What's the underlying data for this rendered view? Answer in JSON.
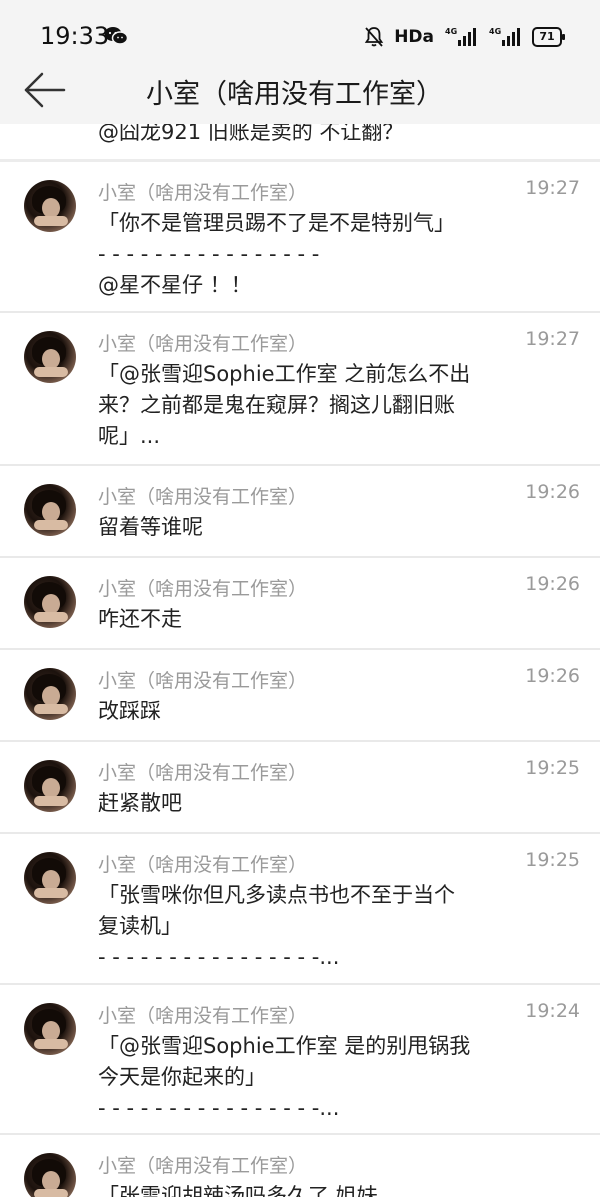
{
  "status_bar": {
    "time": "19:33",
    "hd": "HDa",
    "net1": "4G",
    "net2": "4G",
    "battery": "71"
  },
  "header": {
    "title": "小室（啥用没有工作室）"
  },
  "cut_message": "@囧龙921 旧账是卖的 不让翻？",
  "messages": [
    {
      "sender": "小室（啥用没有工作室）",
      "time": "19:27",
      "lines": [
        "「你不是管理员踢不了是不是特别气」",
        "- - - - - - - - - - - - - - - -",
        "@星不星仔 ！！"
      ]
    },
    {
      "sender": "小室（啥用没有工作室）",
      "time": "19:27",
      "lines": [
        "「@张雪迎Sophie工作室 之前怎么不出",
        "来？之前都是鬼在窥屏？搁这儿翻旧账",
        "呢」..."
      ]
    },
    {
      "sender": "小室（啥用没有工作室）",
      "time": "19:26",
      "lines": [
        "留着等谁呢"
      ]
    },
    {
      "sender": "小室（啥用没有工作室）",
      "time": "19:26",
      "lines": [
        "咋还不走"
      ]
    },
    {
      "sender": "小室（啥用没有工作室）",
      "time": "19:26",
      "lines": [
        "改踩踩"
      ]
    },
    {
      "sender": "小室（啥用没有工作室）",
      "time": "19:25",
      "lines": [
        "赶紧散吧"
      ]
    },
    {
      "sender": "小室（啥用没有工作室）",
      "time": "19:25",
      "lines": [
        "「张雪咪你但凡多读点书也不至于当个",
        "复读机」",
        "- - - - - - - - - - - - - - - -..."
      ]
    },
    {
      "sender": "小室（啥用没有工作室）",
      "time": "19:24",
      "lines": [
        "「@张雪迎Sophie工作室 是的别甩锅我",
        "今天是你起来的」",
        "- - - - - - - - - - - - - - - -..."
      ]
    },
    {
      "sender": "小室（啥用没有工作室）",
      "time": "",
      "lines": [
        "「张雪迎胡辣汤吗多久了 姐妹"
      ]
    }
  ]
}
